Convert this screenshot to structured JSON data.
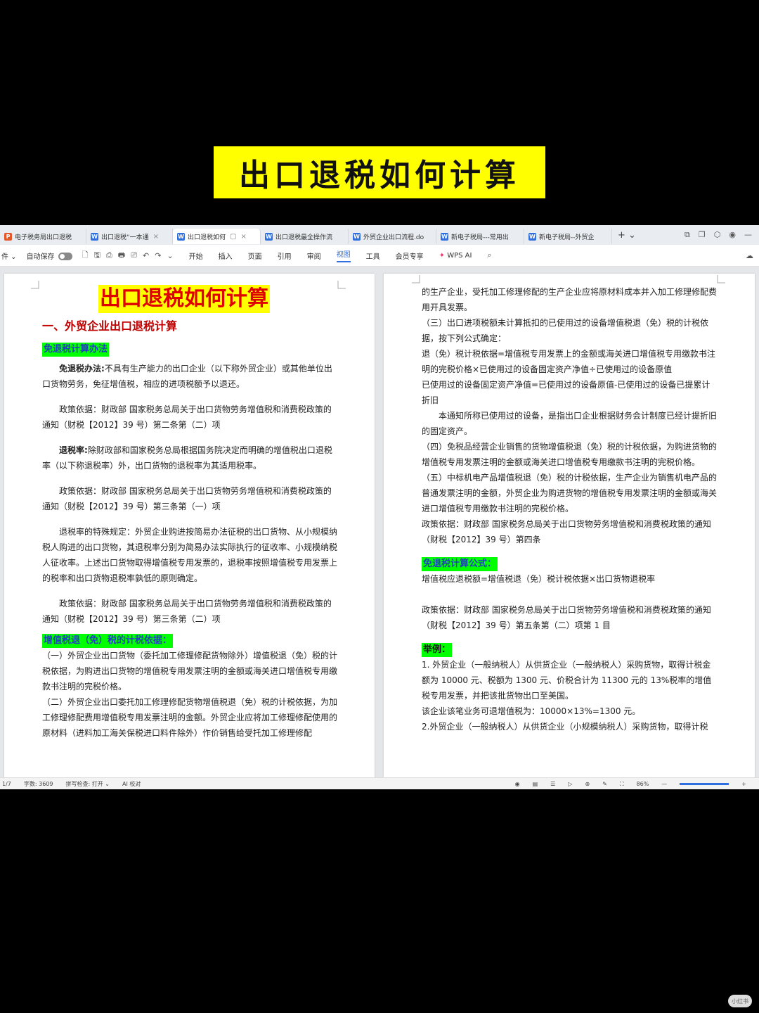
{
  "banner": {
    "title": "出口退税如何计算"
  },
  "tabs": [
    {
      "icon": "P",
      "label": "电子税务局出口退税",
      "active": false
    },
    {
      "icon": "W",
      "label": "出口退税“一本通",
      "active": false
    },
    {
      "icon": "W",
      "label": "出口退税如何",
      "active": true
    },
    {
      "icon": "W",
      "label": "出口退税最全操作流",
      "active": false
    },
    {
      "icon": "W",
      "label": "外贸企业出口流程.do",
      "active": false
    },
    {
      "icon": "W",
      "label": "新电子税局---常用出",
      "active": false
    },
    {
      "icon": "W",
      "label": "新电子税局--外贸企",
      "active": false
    }
  ],
  "tabbar": {
    "add": "+ ⌄"
  },
  "ribbon": {
    "file": "件 ⌄",
    "autosave": "自动保存",
    "menus": [
      "开始",
      "插入",
      "页面",
      "引用",
      "审阅",
      "视图",
      "工具",
      "会员专享",
      "WPS AI"
    ],
    "selected_menu": "视图"
  },
  "page_left": {
    "title": "出口退税如何计算",
    "h1": "一、外贸企业出口退税计算",
    "sec1": "免退税计算办法",
    "p1_bold": "免退税办法:",
    "p1_text": "不具有生产能力的出口企业（以下称外贸企业）或其他单位出口货物劳务，免征增值税，相应的进项税额予以退还。",
    "p2": "政策依据：财政部 国家税务总局关于出口货物劳务增值税和消费税政策的通知（财税【2012】39 号）第二条第（二）项",
    "p3_bold": "退税率:",
    "p3_text": "除财政部和国家税务总局根据国务院决定而明确的增值税出口退税率（以下称退税率）外，出口货物的退税率为其适用税率。",
    "p4": "政策依据：财政部 国家税务总局关于出口货物劳务增值税和消费税政策的通知（财税【2012】39 号）第三条第（一）项",
    "p5": "退税率的特殊规定：外贸企业购进按简易办法征税的出口货物、从小规模纳税人购进的出口货物，其退税率分别为简易办法实际执行的征收率、小规模纳税人征收率。上述出口货物取得增值税专用发票的，退税率按照增值税专用发票上的税率和出口货物退税率孰低的原则确定。",
    "p6": "政策依据：财政部 国家税务总局关于出口货物劳务增值税和消费税政策的通知（财税【2012】39 号）第三条第（二）项",
    "sec2": "增值税退（免）税的计税依据：",
    "p7": "（一）外贸企业出口货物（委托加工修理修配货物除外）增值税退（免）税的计税依据，为购进出口货物的增值税专用发票注明的金额或海关进口增值税专用缴款书注明的完税价格。",
    "p8": "（二）外贸企业出口委托加工修理修配货物增值税退（免）税的计税依据，为加工修理修配费用增值税专用发票注明的金额。外贸企业应将加工修理修配使用的原材料（进料加工海关保税进口料件除外）作价销售给受托加工修理修配"
  },
  "page_right": {
    "r1": "的生产企业，受托加工修理修配的生产企业应将原材料成本并入加工修理修配费用开具发票。",
    "r2": "（三）出口进项税额未计算抵扣的已使用过的设备增值税退（免）税的计税依据，按下列公式确定：",
    "r3": "退（免）税计税依据=增值税专用发票上的金额或海关进口增值税专用缴款书注明的完税价格×已使用过的设备固定资产净值÷已使用过的设备原值",
    "r4": "已使用过的设备固定资产净值=已使用过的设备原值-已使用过的设备已提累计折旧",
    "r5": "本通知所称已使用过的设备，是指出口企业根据财务会计制度已经计提折旧的固定资产。",
    "r6": "（四）免税品经营企业销售的货物增值税退（免）税的计税依据，为购进货物的增值税专用发票注明的金额或海关进口增值税专用缴款书注明的完税价格。",
    "r7": "（五）中标机电产品增值税退（免）税的计税依据，生产企业为销售机电产品的普通发票注明的金额，外贸企业为购进货物的增值税专用发票注明的金额或海关进口增值税专用缴款书注明的完税价格。",
    "r8": "政策依据：财政部 国家税务总局关于出口货物劳务增值税和消费税政策的通知（财税【2012】39 号）第四条",
    "sec3": "免退税计算公式：",
    "r9": "增值税应退税额=增值税退（免）税计税依据×出口货物退税率",
    "r10": "政策依据：财政部 国家税务总局关于出口货物劳务增值税和消费税政策的通知（财税【2012】39 号）第五条第（二）项第 1 目",
    "sec4": "举例：",
    "r11": "1. 外贸企业（一般纳税人）从供货企业（一般纳税人）采购货物，取得计税金额为 10000 元、税额为 1300 元、价税合计为 11300 元的 13%税率的增值税专用发票，并把该批货物出口至美国。",
    "r12": "该企业该笔业务可退增值税为：10000×13%=1300 元。",
    "r13": "2.外贸企业（一般纳税人）从供货企业（小规模纳税人）采购货物，取得计税"
  },
  "statusbar": {
    "page": "1/7",
    "words": "字数: 3609",
    "spell": "拼写检查: 打开 ⌄",
    "ai": "AI 校对",
    "zoom": "86%"
  },
  "watermark": "小红书"
}
